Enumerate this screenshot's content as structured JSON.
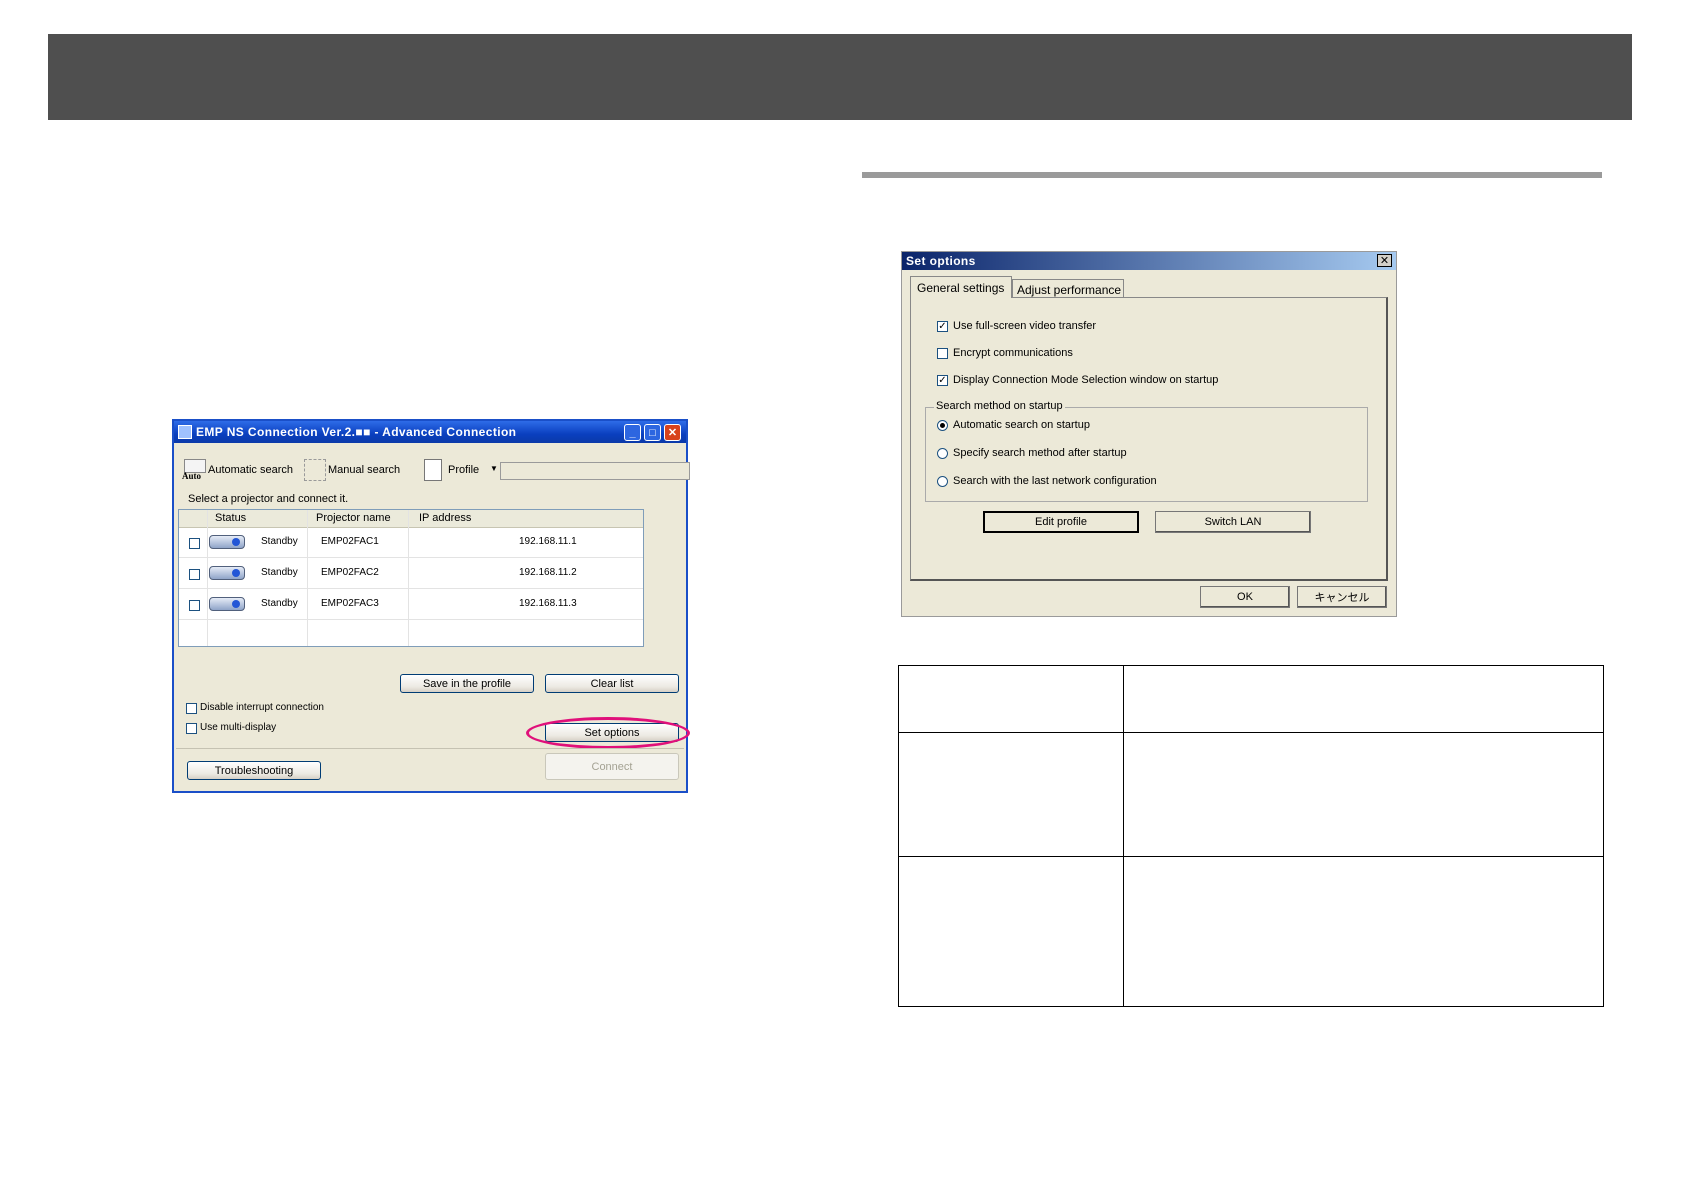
{
  "left_window": {
    "title": "EMP NS Connection Ver.2.■■ - Advanced Connection",
    "toolbar": {
      "auto_icon_label": "Auto",
      "automatic_search": "Automatic search",
      "manual_search": "Manual search",
      "profile": "Profile"
    },
    "instruction": "Select a projector and connect it.",
    "columns": [
      "Status",
      "Projector name",
      "IP address"
    ],
    "rows": [
      {
        "status": "Standby",
        "name": "EMP02FAC1",
        "ip": "192.168.11.1"
      },
      {
        "status": "Standby",
        "name": "EMP02FAC2",
        "ip": "192.168.11.2"
      },
      {
        "status": "Standby",
        "name": "EMP02FAC3",
        "ip": "192.168.11.3"
      }
    ],
    "save_profile": "Save in the profile",
    "clear_list": "Clear list",
    "disable_interrupt": "Disable interrupt connection",
    "use_multi_display": "Use multi-display",
    "set_options": "Set options",
    "troubleshooting": "Troubleshooting",
    "connect": "Connect",
    "highlight_color": "#e0107a"
  },
  "right_window": {
    "title": "Set options",
    "tabs": [
      "General settings",
      "Adjust performance"
    ],
    "checkboxes": [
      {
        "label": "Use full-screen video transfer",
        "checked": true
      },
      {
        "label": "Encrypt communications",
        "checked": false
      },
      {
        "label": "Display Connection Mode Selection window on startup",
        "checked": true
      }
    ],
    "search_group_title": "Search method on startup",
    "radios": [
      {
        "label": "Automatic search on startup",
        "selected": true
      },
      {
        "label": "Specify search method after startup",
        "selected": false
      },
      {
        "label": "Search with the last network configuration",
        "selected": false
      }
    ],
    "edit_profile": "Edit profile",
    "switch_lan": "Switch LAN",
    "ok": "OK",
    "cancel": "キャンセル"
  },
  "colors": {
    "header_bar": "#4f4f4f",
    "rule": "#9a9a9a",
    "window_face": "#ece9d8",
    "xp_blue": "#0a3fbf"
  }
}
